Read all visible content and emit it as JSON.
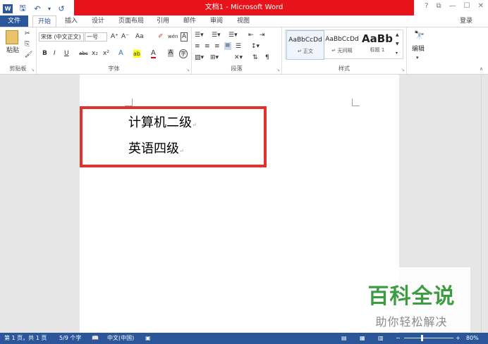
{
  "app": {
    "title": "文档1 - Microsoft Word",
    "quick_access": [
      {
        "icon": "word-logo-icon",
        "glyph": "W"
      },
      {
        "icon": "save-icon",
        "glyph": "🖫"
      },
      {
        "icon": "undo-icon",
        "glyph": "↶"
      },
      {
        "icon": "undo-dropdown-icon",
        "glyph": "▾"
      },
      {
        "icon": "redo-icon",
        "glyph": "↺"
      },
      {
        "icon": "customize-qat-icon",
        "glyph": "▾"
      }
    ],
    "window_controls": [
      "?",
      "⧉",
      "—",
      "☐",
      "✕"
    ]
  },
  "tabs": [
    "文件",
    "开始",
    "插入",
    "设计",
    "页面布局",
    "引用",
    "邮件",
    "审阅",
    "视图"
  ],
  "login_label": "登录",
  "ribbon": {
    "clipboard": {
      "paste_label": "粘贴",
      "group_label": "剪贴板"
    },
    "font": {
      "font_name": "宋体 (中文正文)",
      "font_size": "一号",
      "grow": "A⁺",
      "shrink": "A⁻",
      "change_case": "Aa",
      "clear_format": "✐",
      "phonetic": "wén",
      "border_char": "A",
      "row2": [
        "B",
        "I",
        "U",
        "abc",
        "x₂",
        "x²",
        "A",
        "ab",
        "A",
        "A",
        "字"
      ],
      "group_label": "字体"
    },
    "paragraph": {
      "group_label": "段落"
    },
    "styles": {
      "items": [
        {
          "preview": "AaBbCcDd",
          "name": "↵ 正文"
        },
        {
          "preview": "AaBbCcDd",
          "name": "↵ 无间隔"
        },
        {
          "preview": "AaBb",
          "name": "标题 1"
        }
      ],
      "group_label": "样式"
    },
    "editing": {
      "label": "编辑"
    }
  },
  "document": {
    "lines": [
      "计算机二级",
      "英语四级"
    ],
    "para_mark": "↵"
  },
  "watermark": {
    "title": "百科全说",
    "subtitle": "助你轻松解决"
  },
  "status": {
    "page": "第 1 页，共 1 页",
    "words": "5/9 个字",
    "language": "中文(中国)",
    "zoom": "80%",
    "zoom_minus": "−",
    "zoom_plus": "+"
  }
}
